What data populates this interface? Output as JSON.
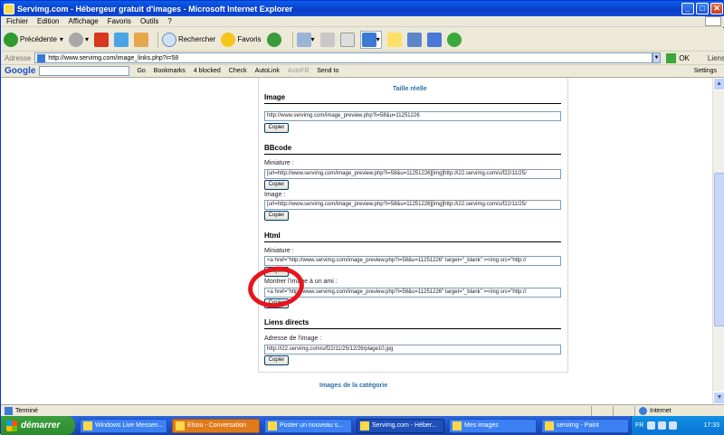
{
  "window": {
    "title": "Servimg.com - Hébergeur gratuit d'images - Microsoft Internet Explorer",
    "min": "_",
    "max": "□",
    "close": "✕"
  },
  "menu": [
    "Fichier",
    "Edition",
    "Affichage",
    "Favoris",
    "Outils",
    "?"
  ],
  "toolbar": {
    "back": "Précédente",
    "search": "Rechercher",
    "favorites": "Favoris"
  },
  "address": {
    "label": "Adresse",
    "url": "http://www.servimg.com/image_links.php?i=58",
    "go": "OK",
    "links": "Liens"
  },
  "google": {
    "logo": "Google",
    "go": "Go",
    "bookmarks": "Bookmarks",
    "blocked": "4 blocked",
    "check": "Check",
    "autolink": "AutoLink",
    "autofill": "AutoFill",
    "sendto": "Send to",
    "settings": "Settings"
  },
  "page": {
    "taille_reelle": "Taille réelle",
    "image_section": "Image",
    "image_url": "http://www.servimg.com/image_preview.php?i=58&u=11251226",
    "copy": "Copier",
    "bbcode_section": "BBcode",
    "bb_miniature_label": "Miniature :",
    "bb_miniature_value": "[url=http://www.servimg.com/image_preview.php?i=58&u=11251226][img]http://i22.servimg.com/u/f22/11/25/",
    "bb_image_label": "Image :",
    "bb_image_value": "[url=http://www.servimg.com/image_preview.php?i=58&u=11251226][img]http://i22.servimg.com/u/f22/11/25/",
    "html_section": "Html",
    "html_miniature_label": "Miniature :",
    "html_miniature_value": "<a href=\"http://www.servimg.com/image_preview.php?i=58&u=11251226\" target=\"_blank\" ><img src=\"http://",
    "html_friend_label": "Montrer l'image à un ami :",
    "html_friend_value": "<a href=\"http://www.servimg.com/image_preview.php?i=58&u=11251226\" target=\"_blank\" ><img src=\"http://",
    "direct_section": "Liens directs",
    "direct_label": "Adresse de l'image :",
    "direct_value": "http://i22.servimg.com/u/f22/11/25/12/26/plage10.jpg",
    "category_link": "Images de la catégorie"
  },
  "status": {
    "text": "Terminé",
    "zone": "Internet"
  },
  "taskbar": {
    "start": "démarrer",
    "items": [
      "Windows Live Messen...",
      "Elsou - Conversation",
      "Poster un nouveau s...",
      "Servimg.com - Héber...",
      "Mes images",
      "servimg - Paint"
    ],
    "lang": "FR",
    "clock": "17:33"
  }
}
